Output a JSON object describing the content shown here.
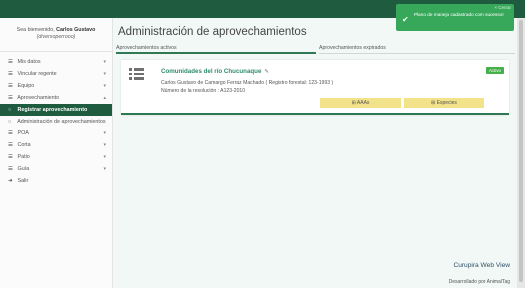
{
  "sidebar": {
    "welcome_prefix": "Sea bienvenido,",
    "user_name": "Carlos Gustavo",
    "user_handle": "(diversoperrooo)",
    "items": [
      {
        "label": "Mis datos",
        "icon": "list-icon",
        "chevron": "▾"
      },
      {
        "label": "Vincular regente",
        "icon": "list-icon",
        "chevron": "▾"
      },
      {
        "label": "Equipo",
        "icon": "list-icon",
        "chevron": "▾"
      },
      {
        "label": "Aprovechamiento",
        "icon": "list-icon",
        "chevron": "▴"
      },
      {
        "label": "Registrar aprovechamiento",
        "icon": "circle-icon"
      },
      {
        "label": "Administración de aprovechamientos",
        "icon": "circle-icon"
      },
      {
        "label": "POA",
        "icon": "list-icon",
        "chevron": "▾"
      },
      {
        "label": "Corta",
        "icon": "list-icon",
        "chevron": "▾"
      },
      {
        "label": "Patio",
        "icon": "list-icon",
        "chevron": "▾"
      },
      {
        "label": "Guía",
        "icon": "list-icon",
        "chevron": "▾"
      },
      {
        "label": "Salir",
        "icon": "logout-icon"
      }
    ]
  },
  "main": {
    "title": "Administración de aprovechamientos",
    "tabs": [
      {
        "label": "Aprovechamientos activos"
      },
      {
        "label": "Aprovechamientos expirados"
      }
    ],
    "card": {
      "title": "Comunidades del río Chucunaque",
      "owner": "Carlos Gustavo de Camargo Ferraz Machado ( Registro forestal: 123-1993 )",
      "resolution": "Número de la resolución : A123-2010",
      "status": "Activo",
      "buttons": [
        {
          "label": "AAAs",
          "icon": "grid-icon"
        },
        {
          "label": "Especies",
          "icon": "grid-icon"
        }
      ]
    }
  },
  "footer": {
    "brand": "Curupira Web View",
    "credit": "Desarrollado por AnimalTag"
  },
  "toast": {
    "message": "Plano de manejo cadastrado com sucesso!",
    "close": "× Cerrar"
  },
  "colors": {
    "primary": "#1f5b3f",
    "accent": "#2f7a55",
    "badge": "#45b04a",
    "button": "#f2e28a",
    "toast": "#37a85a"
  }
}
